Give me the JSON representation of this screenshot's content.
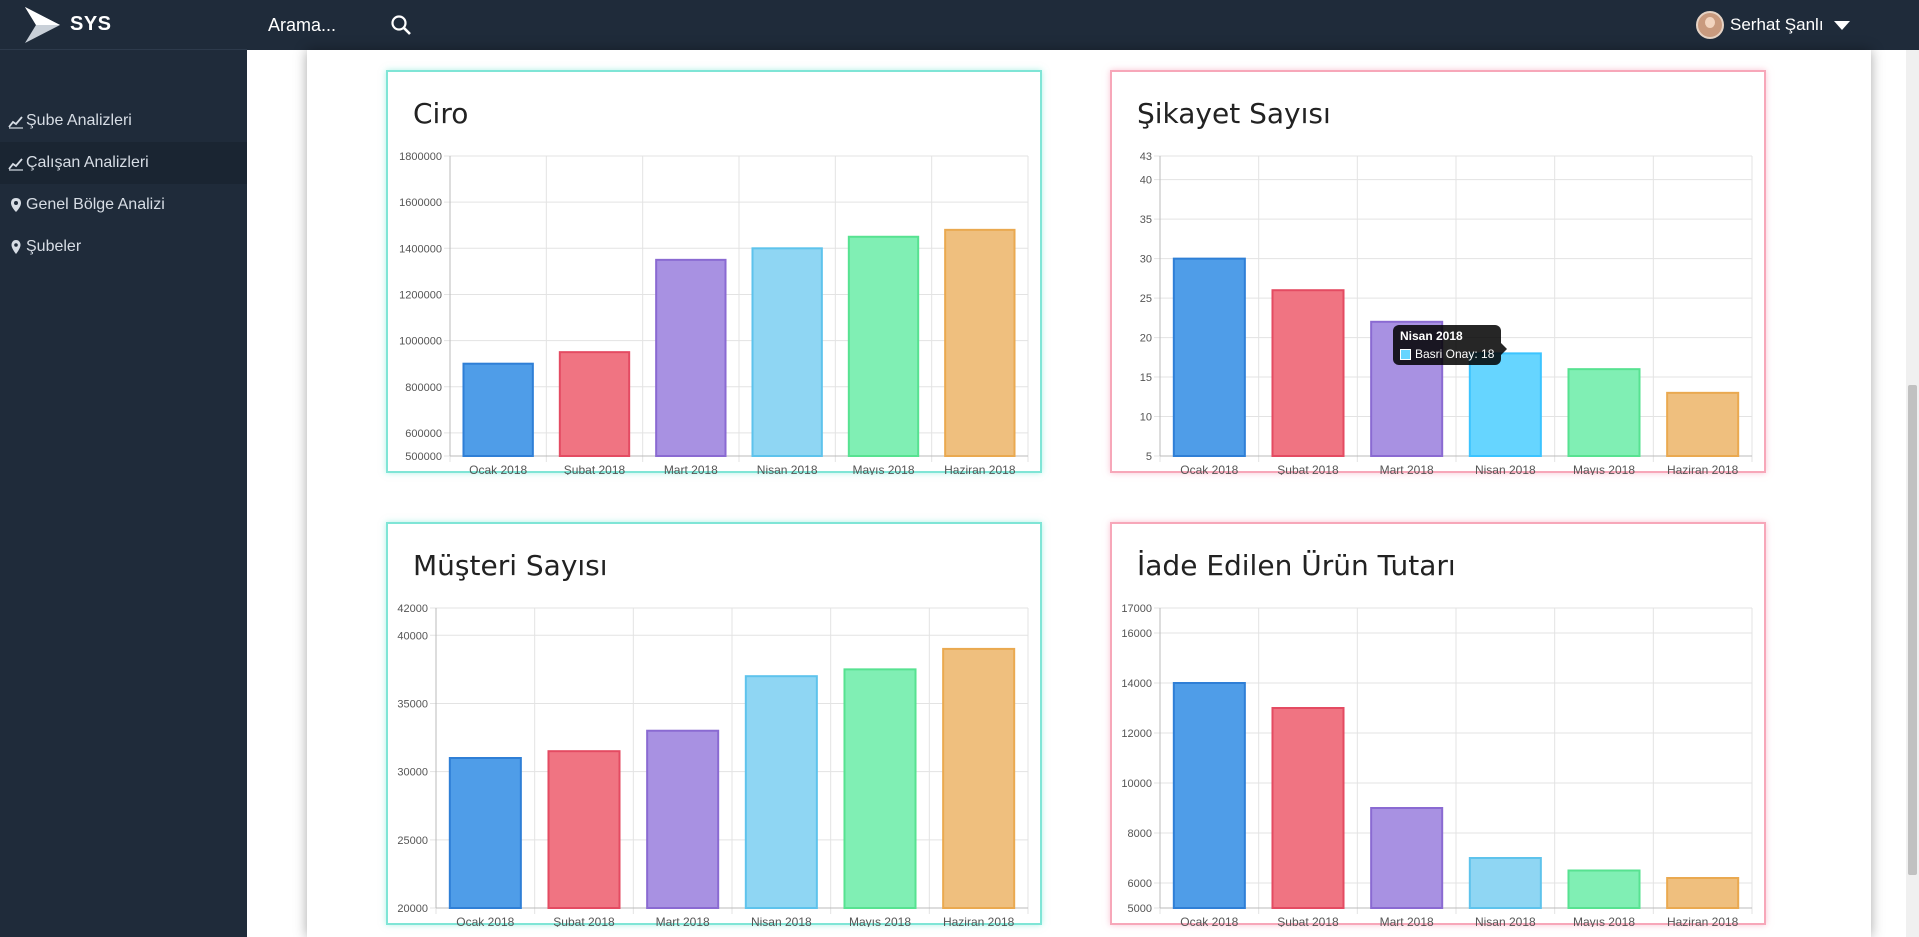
{
  "app": {
    "brand": "SYS"
  },
  "search": {
    "placeholder": "Arama..."
  },
  "user": {
    "name": "Serhat Şanlı"
  },
  "sidebar": {
    "items": [
      {
        "label": "Şube Analizleri",
        "icon": "chart-line-icon",
        "active": false
      },
      {
        "label": "Çalışan Analizleri",
        "icon": "chart-line-icon",
        "active": true
      },
      {
        "label": "Genel Bölge Analizi",
        "icon": "location-shield-icon",
        "active": false
      },
      {
        "label": "Şubeler",
        "icon": "map-pin-icon",
        "active": false
      }
    ]
  },
  "colors": {
    "bg": "#1f2b3a",
    "blue": "#4f9de8",
    "blue_b": "#2f7fd6",
    "red": "#f07482",
    "red_b": "#e44b62",
    "purple": "#a891e2",
    "purple_b": "#8a6ad2",
    "cyan": "#8fd6f3",
    "cyan_b": "#5ec3ec",
    "cyan2": "#66d5ff",
    "cyan2_b": "#3cc4ff",
    "green": "#80efb4",
    "green_b": "#57e291",
    "orange": "#efbf7e",
    "orange_b": "#eaa950"
  },
  "chart_data": [
    {
      "id": "ciro",
      "type": "bar",
      "title": "Ciro",
      "categories": [
        "Ocak 2018",
        "Şubat 2018",
        "Mart 2018",
        "Nisan 2018",
        "Mayıs 2018",
        "Haziran 2018"
      ],
      "values": [
        900000,
        950000,
        1350000,
        1400000,
        1450000,
        1480000
      ],
      "ylim": [
        500000,
        1800000
      ],
      "yticks": [
        500000,
        600000,
        800000,
        1000000,
        1200000,
        1400000,
        1600000,
        1800000
      ],
      "grid": true
    },
    {
      "id": "sikayet",
      "type": "bar",
      "title": "Şikayet Sayısı",
      "categories": [
        "Ocak 2018",
        "Şubat 2018",
        "Mart 2018",
        "Nisan 2018",
        "Mayıs 2018",
        "Haziran 2018"
      ],
      "values": [
        30,
        26,
        22,
        18,
        16,
        13
      ],
      "ylim": [
        5,
        43
      ],
      "yticks": [
        5,
        10,
        15,
        20,
        25,
        30,
        35,
        40,
        43
      ],
      "grid": true,
      "tooltip": {
        "title": "Nisan 2018",
        "body": "Basri Onay: 18"
      }
    },
    {
      "id": "musteri",
      "type": "bar",
      "title": "Müşteri Sayısı",
      "categories": [
        "Ocak 2018",
        "Şubat 2018",
        "Mart 2018",
        "Nisan 2018",
        "Mayıs 2018",
        "Haziran 2018"
      ],
      "values": [
        31000,
        31500,
        33000,
        37000,
        37500,
        39000
      ],
      "ylim": [
        20000,
        42000
      ],
      "yticks": [
        20000,
        25000,
        30000,
        35000,
        40000,
        42000
      ],
      "grid": true
    },
    {
      "id": "iade",
      "type": "bar",
      "title": "İade Edilen Ürün Tutarı",
      "categories": [
        "Ocak 2018",
        "Şubat 2018",
        "Mart 2018",
        "Nisan 2018",
        "Mayıs 2018",
        "Haziran 2018"
      ],
      "values": [
        14000,
        13000,
        9000,
        7000,
        6500,
        6200
      ],
      "ylim": [
        5000,
        17000
      ],
      "yticks": [
        5000,
        6000,
        8000,
        10000,
        12000,
        14000,
        16000,
        17000
      ],
      "grid": true
    }
  ]
}
